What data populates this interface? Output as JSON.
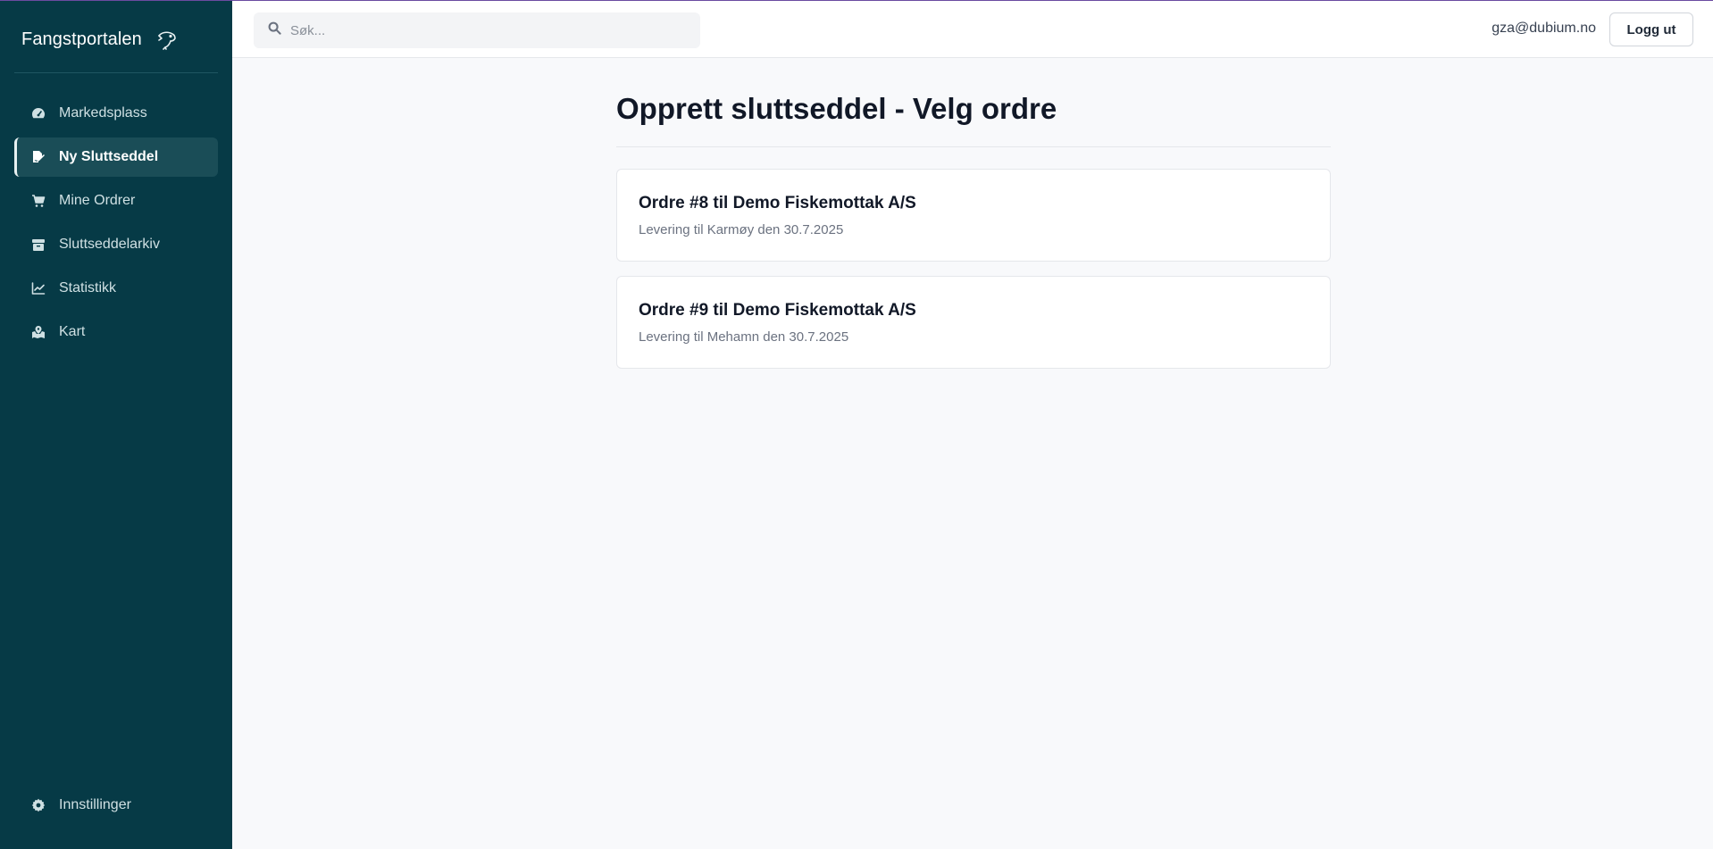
{
  "app": {
    "name": "Fangstportalen",
    "logo_icon": "fish-icon"
  },
  "sidebar": {
    "items": [
      {
        "label": "Markedsplass",
        "icon": "gauge-icon",
        "active": false
      },
      {
        "label": "Ny Sluttseddel",
        "icon": "file-signature-icon",
        "active": true
      },
      {
        "label": "Mine Ordrer",
        "icon": "cart-icon",
        "active": false
      },
      {
        "label": "Sluttseddelarkiv",
        "icon": "archive-icon",
        "active": false
      },
      {
        "label": "Statistikk",
        "icon": "line-chart-icon",
        "active": false
      },
      {
        "label": "Kart",
        "icon": "map-icon",
        "active": false
      }
    ],
    "settings_label": "Innstillinger"
  },
  "header": {
    "search_placeholder": "Søk...",
    "user_email": "gza@dubium.no",
    "logout_label": "Logg ut"
  },
  "page": {
    "title": "Opprett sluttseddel - Velg ordre",
    "orders": [
      {
        "title": "Ordre #8 til Demo Fiskemottak A/S",
        "subtitle": "Levering til Karmøy den 30.7.2025"
      },
      {
        "title": "Ordre #9 til Demo Fiskemottak A/S",
        "subtitle": "Levering til Mehamn den 30.7.2025"
      }
    ]
  },
  "colors": {
    "sidebar_bg": "#063a46",
    "active_item_bg": "#1a4d57",
    "page_bg": "#f8f9fb"
  }
}
